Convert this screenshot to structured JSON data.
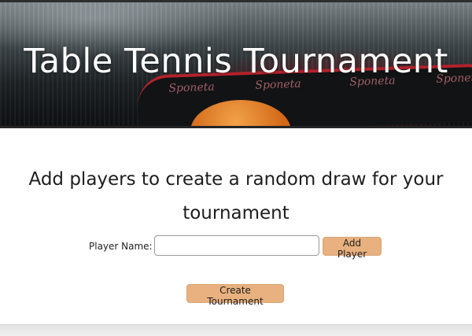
{
  "header": {
    "title": "Table Tennis Tournament",
    "paddle_brand": "Sponeta"
  },
  "main": {
    "intro": "Add players to create a random draw for your tournament",
    "form": {
      "player_label": "Player Name:",
      "player_value": "",
      "player_placeholder": "",
      "add_button": "Add Player"
    },
    "create_button": "Create Tournament"
  },
  "colors": {
    "button_bg": "#e8b17f",
    "button_border": "#d9a574",
    "text": "#1e1e1e"
  }
}
